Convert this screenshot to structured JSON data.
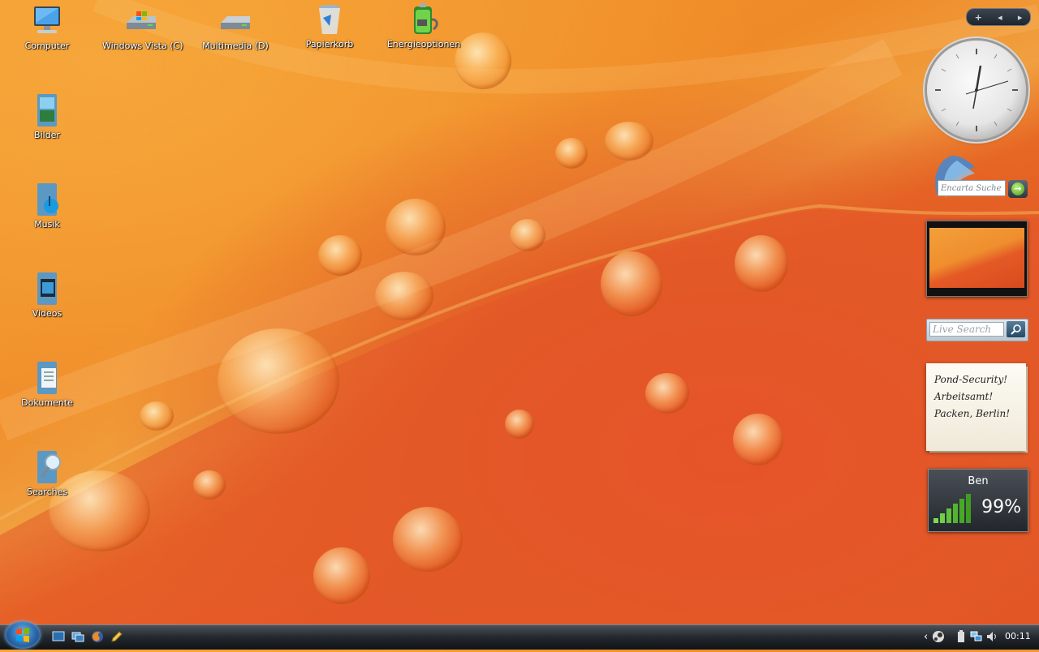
{
  "desktop": {
    "icons": [
      {
        "label": "Computer"
      },
      {
        "label": "Windows Vista (C)"
      },
      {
        "label": "Multimedia (D)"
      },
      {
        "label": "Papierkorb"
      },
      {
        "label": "Energieoptionen"
      },
      {
        "label": "Bilder"
      },
      {
        "label": "Musik"
      },
      {
        "label": "Videos"
      },
      {
        "label": "Dokumente"
      },
      {
        "label": "Searches"
      }
    ]
  },
  "sidebar": {
    "controls": {
      "add": "+",
      "prev": "◂",
      "next": "▸"
    },
    "encarta": {
      "placeholder": "Encarta Suche",
      "go": "→"
    },
    "live_search": {
      "placeholder": "Live Search",
      "go_icon": "search-icon"
    },
    "note": {
      "lines": [
        "Pond-Security!",
        "Arbeitsamt!",
        "Packen, Berlin!"
      ]
    },
    "wifi": {
      "network": "Ben",
      "signal": "99%",
      "signal_level": 0.99
    }
  },
  "taskbar": {
    "quick_launch": [
      "show-desktop-icon",
      "switch-windows-icon",
      "firefox-icon",
      "pencil-icon"
    ],
    "tray": {
      "expand": "‹"
    },
    "time": "00:11"
  },
  "colors": {
    "accent": "#2c6cb0",
    "taskbar": "#262b31",
    "wallpaper_orange": "#ef8a28",
    "wallpaper_red": "#e3522a"
  }
}
